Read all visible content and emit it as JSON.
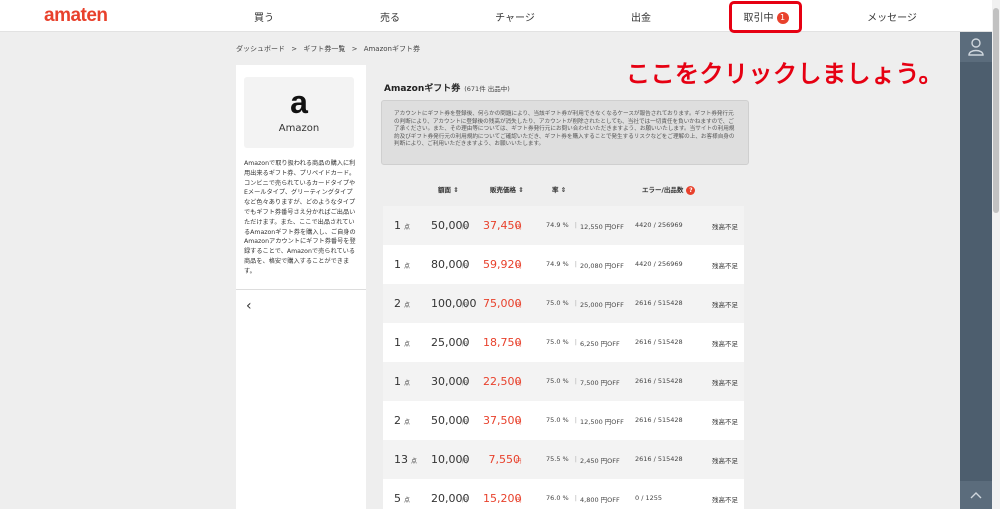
{
  "header": {
    "logo": "amaten",
    "nav": [
      {
        "label": "買う"
      },
      {
        "label": "売る"
      },
      {
        "label": "チャージ"
      },
      {
        "label": "出金"
      },
      {
        "label": "取引中",
        "badge": "1"
      },
      {
        "label": "メッセージ"
      }
    ]
  },
  "breadcrumb": [
    "ダッシュボード",
    ">",
    "ギフト券一覧",
    ">",
    "Amazonギフト券"
  ],
  "annotation": "ここをクリックしましょう。",
  "product": {
    "logo_letter": "a",
    "name": "Amazon",
    "description": "Amazonで取り扱われる商品の購入に利用出来るギフト券、プリペイドカード。コンビニで売られているカードタイプやEメールタイプ、グリーティングタイプなど色々ありますが、どのようなタイプでもギフト券番号さえ分かればご出品いただけます。また、ここで出品されているAmazonギフト券を購入し、ご自身のAmazonアカウントにギフト券番号を登録することで、Amazonで売られている商品を、格安で購入することができます。"
  },
  "main": {
    "title": "Amazonギフト券",
    "count": "(671件 出品中)",
    "notice": "アカウントにギフト券を登録後、何らかの問題により、当該ギフト券が利用できなくなるケースが報告されております。ギフト券発行元の判断により、アカウントに登録後の残高が消失したり、アカウントが削除されたとしても、当社では一切責任を負いかねますので、ご了承ください。また、その理由等については、ギフト券発行元にお問い合わせいただきますよう、お願いいたします。当サイトの利用規約及びギフト券発行元の利用規約についてご確認いただき、ギフト券を購入することで発生するリスクなどをご理解の上、お客様自身の判断により、ご利用いただきますよう、お願いいたします。",
    "columns": {
      "face": "額面",
      "price": "販売価格",
      "rate": "率",
      "error": "エラー/出品数"
    },
    "rows": [
      {
        "qty": "1",
        "qty_unit": "点",
        "face": "50,000",
        "price": "37,450",
        "yen": "円",
        "rate": "74.9 %",
        "off": "12,550 円OFF",
        "err": "4420 / 256969",
        "status": "残高不足"
      },
      {
        "qty": "1",
        "qty_unit": "点",
        "face": "80,000",
        "price": "59,920",
        "yen": "円",
        "rate": "74.9 %",
        "off": "20,080 円OFF",
        "err": "4420 / 256969",
        "status": "残高不足"
      },
      {
        "qty": "2",
        "qty_unit": "点",
        "face": "100,000",
        "price": "75,000",
        "yen": "円",
        "rate": "75.0 %",
        "off": "25,000 円OFF",
        "err": "2616 / 515428",
        "status": "残高不足"
      },
      {
        "qty": "1",
        "qty_unit": "点",
        "face": "25,000",
        "price": "18,750",
        "yen": "円",
        "rate": "75.0 %",
        "off": "6,250 円OFF",
        "err": "2616 / 515428",
        "status": "残高不足"
      },
      {
        "qty": "1",
        "qty_unit": "点",
        "face": "30,000",
        "price": "22,500",
        "yen": "円",
        "rate": "75.0 %",
        "off": "7,500 円OFF",
        "err": "2616 / 515428",
        "status": "残高不足"
      },
      {
        "qty": "2",
        "qty_unit": "点",
        "face": "50,000",
        "price": "37,500",
        "yen": "円",
        "rate": "75.0 %",
        "off": "12,500 円OFF",
        "err": "2616 / 515428",
        "status": "残高不足"
      },
      {
        "qty": "13",
        "qty_unit": "点",
        "face": "10,000",
        "price": "7,550",
        "yen": "円",
        "rate": "75.5 %",
        "off": "2,450 円OFF",
        "err": "2616 / 515428",
        "status": "残高不足"
      },
      {
        "qty": "5",
        "qty_unit": "点",
        "face": "20,000",
        "price": "15,200",
        "yen": "円",
        "rate": "76.0 %",
        "off": "4,800 円OFF",
        "err": "0 / 1255",
        "status": "残高不足"
      }
    ]
  },
  "colors": {
    "brand": "#e8412c",
    "annotation": "#e60012",
    "sidebar": "#4d5e6e"
  }
}
